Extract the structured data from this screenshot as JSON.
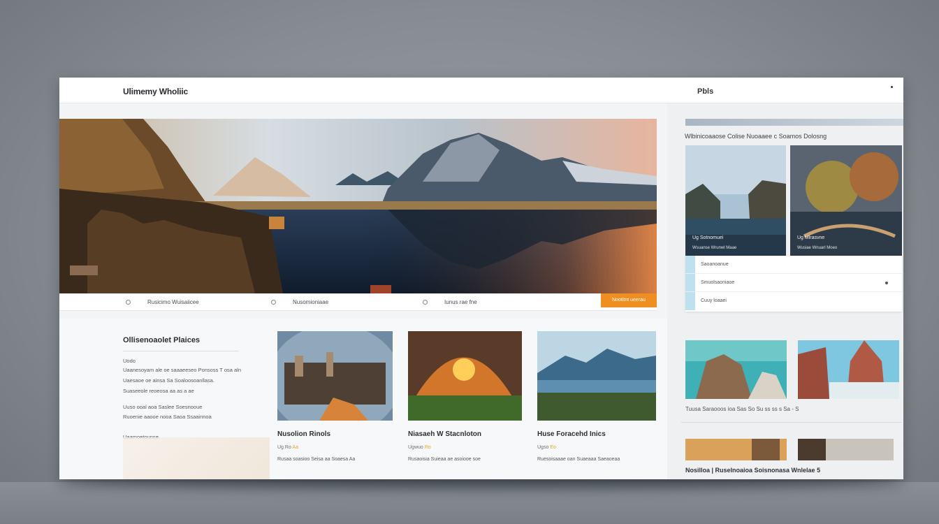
{
  "header": {
    "brand": "Ulimemy Wholiic",
    "nav_link": "Pbls"
  },
  "hero": {
    "captions": [
      "Rusicimo Wuisaiicee",
      "Nusomioniaae",
      "Iunus rae fne"
    ],
    "cta_label": "Nootitnt ueerau"
  },
  "sidebar": {
    "title": "Wlbinicoaaose Colise Nuoaaee c Soamos Dolosng",
    "cards": [
      {
        "label": "Ug Sotnomuei",
        "meta": "Wsuanse Wrunwl Maae"
      },
      {
        "label": "Ug Mlrasvne",
        "meta": "Wusiae Wnuarl Moeo"
      }
    ],
    "list_rows": [
      "Saoanoanue",
      "Smuolsaoniaoe",
      "Cuuy loaaei"
    ],
    "gallery_caption": "Tuusa Saraooos ioa Sas So Su ss ss s Sa - S",
    "footer_text": "Nosilloa | Ruselnoaioa Soisnonasa Wnlelae 5"
  },
  "article": {
    "title": "Ollisenoaolet Plaices",
    "lines": [
      "Uodo",
      "Uaanesoyam ale oe saaaeeseo Ponsoss T osa aln",
      "Uaesaoe oe ainsa Sa Soaloosoanllasa.",
      "Suaseeole reoeosa aa as a ae",
      "Uuso ooal aoa Saslee Soesnooue",
      "Ruoenie aaooe nooa Saoa Ssaainnoa",
      "Uaamoetounse"
    ]
  },
  "cards": [
    {
      "title": "Nusolion Rinols",
      "meta": "Ug Ro",
      "rating": "Aa",
      "desc": "Rusaa soasioo Seisa aa Soaesa Aa"
    },
    {
      "title": "Niasaeh W Stacnloton",
      "meta": "Ugwuo",
      "rating": "Ro",
      "desc": "Rusaoisia Suieaa ae asoiooe soe"
    },
    {
      "title": "Huse Foracehd Inics",
      "meta": "Ugso",
      "rating": "Eo",
      "desc": "Ruesoisaaae oan Suaeaaa Saeaoeaa"
    }
  ]
}
